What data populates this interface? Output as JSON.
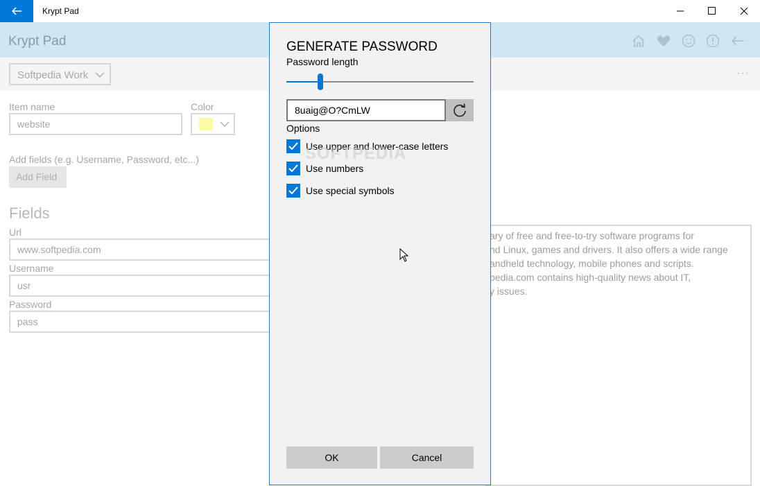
{
  "window": {
    "title": "Krypt Pad",
    "accent": "#0078d7"
  },
  "header": {
    "app_title": "Krypt Pad",
    "icons": [
      "home-icon",
      "heart-icon",
      "smiley-icon",
      "info-icon",
      "back-arrow-icon"
    ]
  },
  "toolbar": {
    "category_selected": "Softpedia Work",
    "more_label": "···"
  },
  "form": {
    "item_name_label": "Item name",
    "item_name_value": "website",
    "color_label": "Color",
    "color_value": "#fbfba4",
    "add_fields_hint": "Add fields (e.g. Username, Password, etc...)",
    "add_field_button": "Add Field",
    "fields_title": "Fields",
    "fields": [
      {
        "label": "Url",
        "value": "www.softpedia.com"
      },
      {
        "label": "Username",
        "value": "usr"
      },
      {
        "label": "Password",
        "value": "pass"
      }
    ],
    "notes_lines": [
      "ary of free and free-to-try software programs for",
      "nd Linux, games and drivers. It also offers a wide range",
      "andheld technology, mobile phones and scripts.",
      "pedia.com contains high-quality news about IT,",
      "y issues."
    ]
  },
  "dialog": {
    "title": "GENERATE PASSWORD",
    "length_label": "Password length",
    "slider_fraction": 0.18,
    "password_value": "8uaig@O?CmLW",
    "options_label": "Options",
    "options": [
      {
        "label": "Use upper and lower-case letters",
        "checked": true
      },
      {
        "label": "Use numbers",
        "checked": true
      },
      {
        "label": "Use special symbols",
        "checked": true
      }
    ],
    "ok_label": "OK",
    "cancel_label": "Cancel"
  },
  "watermark": "SOFTPEDIA"
}
